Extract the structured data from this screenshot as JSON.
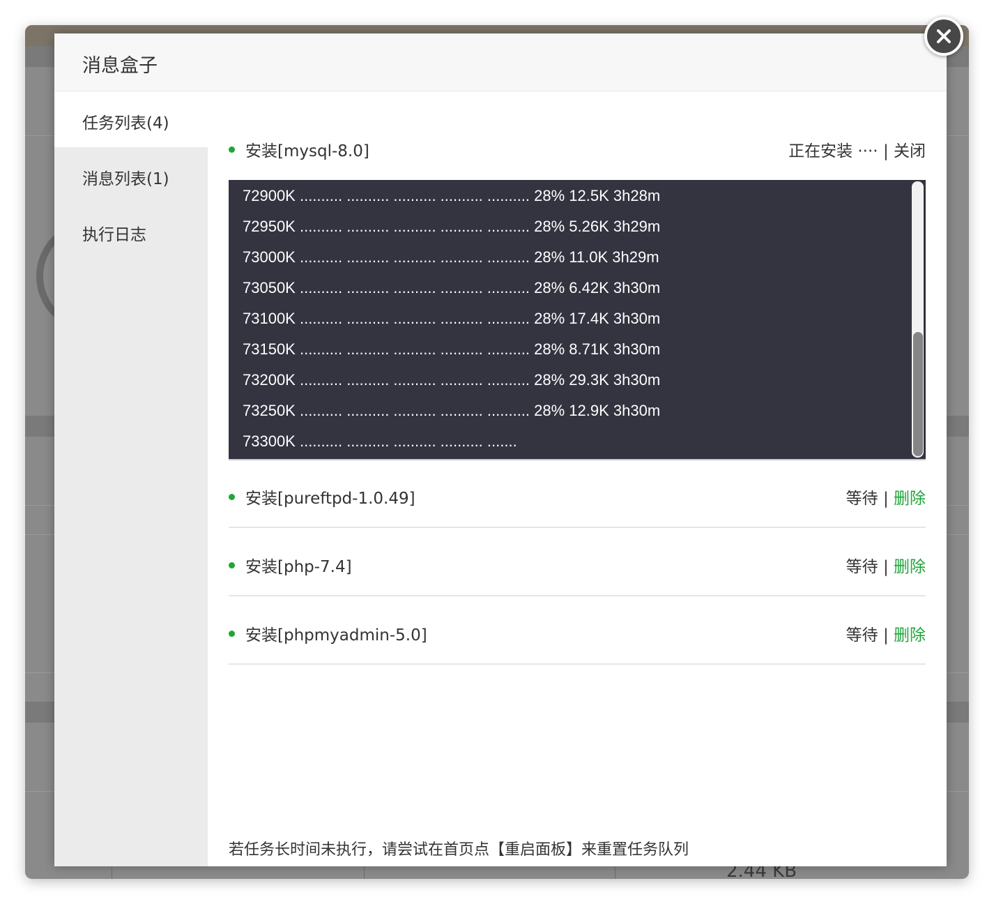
{
  "background": {
    "size_text": "2.44 KB"
  },
  "modal": {
    "title": "消息盒子",
    "sidebar": [
      {
        "label": "任务列表(4)",
        "active": true
      },
      {
        "label": "消息列表(1)",
        "active": false
      },
      {
        "label": "执行日志",
        "active": false
      }
    ]
  },
  "tasks": [
    {
      "name": "安装[mysql-8.0]",
      "status": "正在安装 ····",
      "sep": "|",
      "action": "关闭"
    },
    {
      "name": "安装[pureftpd-1.0.49]",
      "status": "等待",
      "sep": "|",
      "action": "删除"
    },
    {
      "name": "安装[php-7.4]",
      "status": "等待",
      "sep": "|",
      "action": "删除"
    },
    {
      "name": "安装[phpmyadmin-5.0]",
      "status": "等待",
      "sep": "|",
      "action": "删除"
    }
  ],
  "log_lines": [
    "72900K .......... .......... .......... .......... .......... 28% 12.5K 3h28m",
    "72950K .......... .......... .......... .......... .......... 28% 5.26K 3h29m",
    "73000K .......... .......... .......... .......... .......... 28% 11.0K 3h29m",
    "73050K .......... .......... .......... .......... .......... 28% 6.42K 3h30m",
    "73100K .......... .......... .......... .......... .......... 28% 17.4K 3h30m",
    "73150K .......... .......... .......... .......... .......... 28% 8.71K 3h30m",
    "73200K .......... .......... .......... .......... .......... 28% 29.3K 3h30m",
    "73250K .......... .......... .......... .......... .......... 28% 12.9K 3h30m",
    "73300K .......... .......... .......... .......... ......."
  ],
  "footer_note": "若任务长时间未执行，请尝试在首页点【重启面板】来重置任务队列",
  "colors": {
    "accent_green": "#20a53a",
    "log_bg": "#333440"
  }
}
